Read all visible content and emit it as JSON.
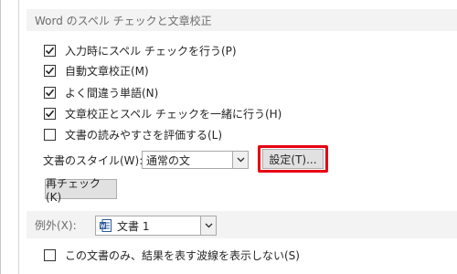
{
  "sections": {
    "proofing_header": "Word のスペル チェックと文章校正",
    "exceptions_label": "例外(X):"
  },
  "options": [
    {
      "label": "入力時にスペル チェックを行う(P)",
      "checked": true
    },
    {
      "label": "自動文章校正(M)",
      "checked": true
    },
    {
      "label": "よく間違う単語(N)",
      "checked": true
    },
    {
      "label": "文章校正とスペル チェックを一緒に行う(H)",
      "checked": true
    },
    {
      "label": "文書の読みやすさを評価する(L)",
      "checked": false
    }
  ],
  "writing_style": {
    "label": "文書のスタイル(W):",
    "value": "通常の文",
    "settings_button": "設定(T)..."
  },
  "recheck_button": "再チェック(K)",
  "exceptions": {
    "document_value": "文書 1",
    "document_icon": "word-document-icon",
    "hide_errors_label": "この文書のみ、結果を表す波線を表示しない(S)",
    "hide_errors_checked": false
  },
  "colors": {
    "highlight": "#e60012",
    "section_bg": "#f3f3f3",
    "word_blue": "#2b579a"
  }
}
